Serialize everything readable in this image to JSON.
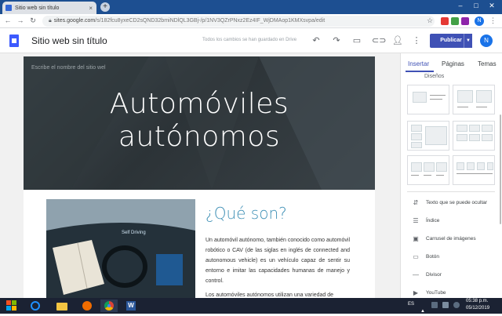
{
  "browser": {
    "tab_title": "Sitio web sin título",
    "tab_close": "×",
    "new_tab": "+",
    "url_prefix": "sites.google.com",
    "url_rest": "/s/182fcu8yxeCD2sQND32bmiNDlQL3GBj-/p/1NV3QZrPNxz2Ez4IF_WjDMAop1KMXsvpa/edit",
    "profile_initial": "N",
    "window_controls": {
      "minimize": "–",
      "maximize": "□",
      "close": "✕"
    }
  },
  "sites": {
    "doc_title": "Sitio web sin título",
    "save_status": "Todos los cambios se han guardado en Drive",
    "publish_label": "Publicar",
    "user_initial": "N"
  },
  "hero": {
    "site_name_placeholder": "Escribe el nombre del sitio wel",
    "title_line1": "Automóviles",
    "title_line2": "autónomos"
  },
  "content": {
    "heading": "¿Qué son?",
    "paragraph1": "Un automóvil autónomo, también conocido como automóvil robótico o CAV (de las siglas en inglés de connected and autonomous vehicle) es un vehículo capaz de sentir su entorno e imitar las capacidades humanas de manejo y control.",
    "paragraph2": "Los automóviles autónomos utilizan una variedad de",
    "image_caption": "Self Driving"
  },
  "panel": {
    "tabs": [
      "Insertar",
      "Páginas",
      "Temas"
    ],
    "active_tab": "Insertar",
    "cut_label": "Diseños",
    "items": [
      {
        "label": "Texto que se puede ocultar",
        "icon": "collapsible-text-icon"
      },
      {
        "label": "Índice",
        "icon": "table-of-contents-icon"
      },
      {
        "label": "Carrusel de imágenes",
        "icon": "image-carousel-icon"
      },
      {
        "label": "Botón",
        "icon": "button-icon"
      },
      {
        "label": "Divisor",
        "icon": "divider-icon"
      },
      {
        "label": "YouTube",
        "icon": "youtube-icon"
      }
    ]
  },
  "taskbar": {
    "language": "ES",
    "time": "05:38 p.m.",
    "date": "05/12/2019"
  },
  "colors": {
    "publish": "#3f51b5",
    "accent_heading": "#3d8fb5",
    "taskbar": "#1b2233",
    "tab_strip": "#1d4f91"
  }
}
